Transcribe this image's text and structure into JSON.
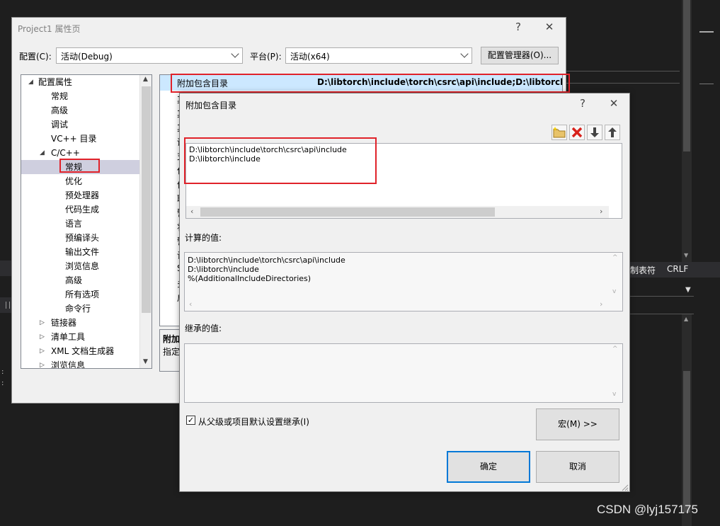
{
  "prop_window": {
    "title": "Project1 属性页",
    "help": "?",
    "close": "✕",
    "config_label": "配置(C):",
    "config_value": "活动(Debug)",
    "platform_label": "平台(P):",
    "platform_value": "活动(x64)",
    "config_manager": "配置管理器(O)...",
    "tree": [
      {
        "label": "配置属性",
        "toggle": "◢"
      },
      {
        "label": "常规"
      },
      {
        "label": "高级"
      },
      {
        "label": "调试"
      },
      {
        "label": "VC++ 目录"
      },
      {
        "label": "C/C++",
        "toggle": "◢"
      },
      {
        "label": "常规"
      },
      {
        "label": "优化"
      },
      {
        "label": "预处理器"
      },
      {
        "label": "代码生成"
      },
      {
        "label": "语言"
      },
      {
        "label": "预编译头"
      },
      {
        "label": "输出文件"
      },
      {
        "label": "浏览信息"
      },
      {
        "label": "高级"
      },
      {
        "label": "所有选项"
      },
      {
        "label": "命令行"
      },
      {
        "label": "链接器",
        "toggle": "▷"
      },
      {
        "label": "清单工具",
        "toggle": "▷"
      },
      {
        "label": "XML 文档生成器",
        "toggle": "▷"
      },
      {
        "label": "浏览信息",
        "toggle": "▷"
      }
    ],
    "grid": {
      "row_name": "附加包含目录",
      "row_value": "D:\\libtorch\\include\\torch\\csrc\\api\\include;D:\\libtorch\\i",
      "side_chars": [
        "其",
        "其",
        "其",
        "调",
        "支",
        "仅",
        "优",
        "取",
        "警",
        "将",
        "警",
        "诊",
        "S",
        "多",
        "启"
      ]
    },
    "desc": {
      "title": "附加",
      "text": "指定"
    }
  },
  "inc_dialog": {
    "title": "附加包含目录",
    "help": "?",
    "close": "✕",
    "lines": [
      "D:\\libtorch\\include\\torch\\csrc\\api\\include",
      "D:\\libtorch\\include"
    ],
    "computed_label": "计算的值:",
    "computed_lines": [
      "D:\\libtorch\\include\\torch\\csrc\\api\\include",
      "D:\\libtorch\\include",
      "%(AdditionalIncludeDirectories)"
    ],
    "inherited_label": "继承的值:",
    "inherit_checkbox": "从父级或项目默认设置继承(I)",
    "macro_button": "宏(M) >>",
    "ok_button": "确定",
    "cancel_button": "取消",
    "tool_icons": [
      "new-folder-icon",
      "delete-icon",
      "move-down-icon",
      "move-up-icon"
    ]
  },
  "ide": {
    "status_tab": "制表符",
    "status_eol": "CRLF"
  },
  "watermark": "CSDN @lyj157175",
  "colors": {
    "highlight_red": "#e0222a",
    "selection": "#cce8ff",
    "ok_border": "#0078d7"
  }
}
